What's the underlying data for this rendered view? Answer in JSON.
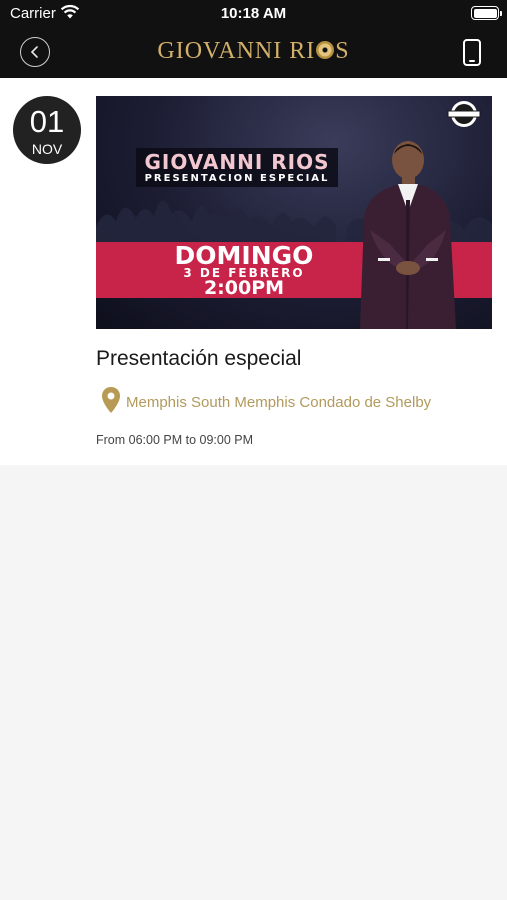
{
  "status_bar": {
    "carrier": "Carrier",
    "time": "10:18 AM"
  },
  "header": {
    "brand_part1": "GIOVANNI RI",
    "brand_part2": "S"
  },
  "event": {
    "date_day": "01",
    "date_month": "NOV",
    "title": "Presentación especial",
    "location": "Memphis South Memphis Condado de Shelby",
    "time_range": "From 06:00 PM to 09:00 PM",
    "poster": {
      "name": "GIOVANNI RIOS",
      "subtitle": "PRESENTACION ESPECIAL",
      "day": "DOMINGO",
      "date": "3 DE FEBRERO",
      "time": "2:00PM"
    }
  },
  "colors": {
    "header_bg": "#111111",
    "brand_gold": "#d2b06a",
    "location_gold": "#b29a5c",
    "poster_band": "#c8244a"
  }
}
